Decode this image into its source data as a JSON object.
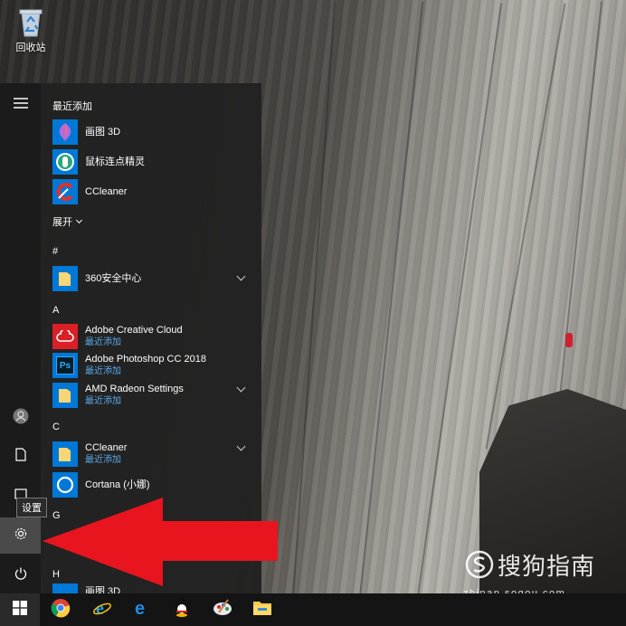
{
  "desktop": {
    "recycle_bin_label": "回收站"
  },
  "start_menu": {
    "recent_header": "最近添加",
    "recent_apps": [
      {
        "name": "画图 3D",
        "icon": "paint3d-icon"
      },
      {
        "name": "鼠标连点精灵",
        "icon": "mouse-clicker-icon"
      },
      {
        "name": "CCleaner",
        "icon": "ccleaner-icon"
      }
    ],
    "expand_label": "展开",
    "sections": [
      {
        "letter": "#",
        "apps": [
          {
            "name": "360安全中心",
            "sub": "",
            "icon": "folder-icon",
            "expandable": true
          }
        ]
      },
      {
        "letter": "A",
        "apps": [
          {
            "name": "Adobe Creative Cloud",
            "sub": "最近添加",
            "icon": "creative-cloud-icon",
            "expandable": false
          },
          {
            "name": "Adobe Photoshop CC 2018",
            "sub": "最近添加",
            "icon": "photoshop-icon",
            "expandable": false
          },
          {
            "name": "AMD Radeon Settings",
            "sub": "最近添加",
            "icon": "folder-icon",
            "expandable": true
          }
        ]
      },
      {
        "letter": "C",
        "apps": [
          {
            "name": "CCleaner",
            "sub": "最近添加",
            "icon": "folder-icon",
            "expandable": true
          },
          {
            "name": "Cortana (小娜)",
            "sub": "",
            "icon": "cortana-icon",
            "expandable": false
          }
        ]
      },
      {
        "letter": "G",
        "apps": []
      },
      {
        "letter": "H",
        "apps": [
          {
            "name": "画图 3D",
            "sub": "",
            "icon": "paint3d-icon",
            "expandable": false
          }
        ]
      }
    ],
    "rail": [
      "hamburger-icon",
      "user-icon",
      "document-icon",
      "pictures-icon",
      "settings-icon",
      "power-icon"
    ],
    "tooltip": "设置"
  },
  "taskbar": {
    "items": [
      "windows-start-icon",
      "chrome-icon",
      "ie-icon",
      "edge-icon",
      "qq-icon",
      "paint-icon",
      "file-explorer-icon"
    ]
  },
  "watermark": {
    "brand": "搜狗指南",
    "url": "zhinan.sogou.com"
  },
  "colors": {
    "accent_blue": "#0078d7",
    "subtitle_blue": "#5aa8e8",
    "arrow_red": "#e8141e",
    "menu_bg": "#222222"
  }
}
